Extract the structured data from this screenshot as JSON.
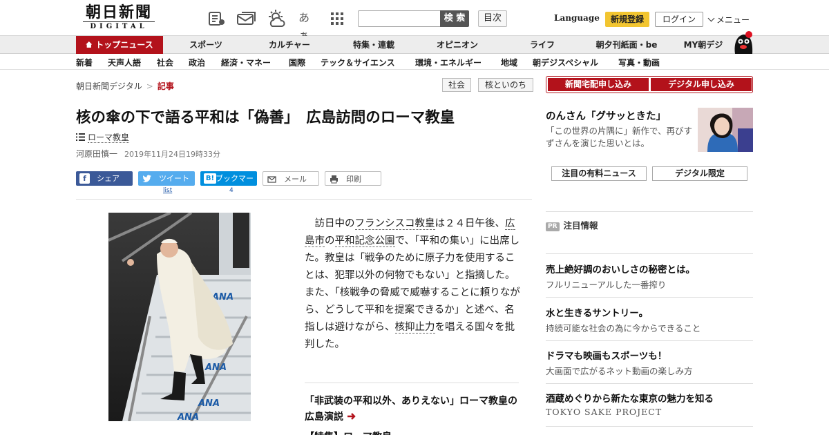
{
  "header": {
    "logo_main": "朝日新聞",
    "logo_sub": "DIGITAL",
    "icons": [
      "newspaper-icon",
      "mail-stack-icon",
      "weather-icon",
      "font-size-icon",
      "grid-menu-icon"
    ],
    "font_size_label": "あぁ",
    "search_placeholder": "",
    "search_label": "検 索",
    "toc_label": "目次",
    "language_label": "Language",
    "register_label": "新規登録",
    "login_label": "ログイン",
    "menu_label": "メニュー"
  },
  "nav_primary": [
    "トップニュース",
    "スポーツ",
    "カルチャー",
    "特集・連載",
    "オピニオン",
    "ライフ",
    "朝夕刊紙面・be",
    "MY朝デジ"
  ],
  "nav_secondary": [
    "新着",
    "天声人語",
    "社会",
    "政治",
    "経済・マネー",
    "国際",
    "テック＆サイエンス",
    "環境・エネルギー",
    "地域",
    "朝デジスペシャル",
    "写真・動画"
  ],
  "breadcrumb": {
    "home": "朝日新聞デジタル",
    "separator": ">",
    "current": "記事"
  },
  "tags": [
    "社会",
    "核といのち"
  ],
  "article": {
    "headline": "核の傘の下で語る平和は「偽善」　広島訪問のローマ教皇",
    "topic": "ローマ教皇",
    "author": "河原田慎一",
    "date": "2019年11月24日19時33分",
    "share": {
      "facebook": "シェア",
      "tweet": "ツイート",
      "bookmark": "ブックマーク",
      "mail": "メール",
      "print": "印刷",
      "tweet_count": "list",
      "bookmark_count": "4"
    },
    "body": {
      "p1": "訪日中の",
      "l1": "フランシスコ教皇",
      "p2": "は２４日午後、",
      "l2": "広島市",
      "p3": "の",
      "l3": "平和記念公園",
      "p4": "で、「平和の集い」に出席した。教皇は「戦争のために原子力を使用することは、犯罪以外の何物でもない」と指摘した。また、「核戦争の脅威で威嚇することに頼りながら、どうして平和を提案できるか」と述べ、名指しは避けながら、",
      "l4": "核抑止力",
      "p5": "を唱える国々を批判した。"
    },
    "related": [
      "「非武装の平和以外、ありえない」ローマ教皇の広島演説",
      "【特集】ローマ教皇"
    ]
  },
  "sidebar": {
    "subscribe": [
      "新聞宅配申し込み",
      "デジタル申し込み"
    ],
    "promo_title": "のんさん「グサッときた」",
    "promo_text": "「この世界の片隅に」新作で、再びすずさんを演じた思いとは。",
    "buttons": [
      "注目の有料ニュース",
      "デジタル限定"
    ],
    "pr_badge": "PR",
    "pr_heading": "注目情報",
    "ads": [
      {
        "title": "売上絶好調のおいしさの秘密とは。",
        "sub": "フルリニューアルした一番搾り"
      },
      {
        "title": "水と生きるサントリー。",
        "sub": "持続可能な社会の為に今からできること"
      },
      {
        "title": "ドラマも映画もスポーツも！",
        "sub": "大画面で広がるネット動画の楽しみ方"
      },
      {
        "title": "酒蔵めぐりから新たな東京の魅力を知る",
        "sub": "TOKYO SAKE PROJECT"
      }
    ]
  },
  "colors": {
    "brand_red": "#b3121b",
    "register_yellow": "#f2c530",
    "facebook": "#3b5998",
    "twitter": "#55acee",
    "hatena": "#008fde"
  }
}
